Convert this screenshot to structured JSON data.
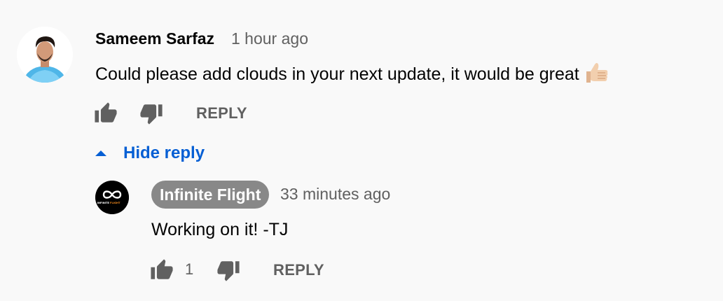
{
  "comment": {
    "author": "Sameem Sarfaz",
    "timestamp": "1 hour ago",
    "text": "Could please add clouds in your next update, it would be great",
    "emoji": "thumbs-up-emoji",
    "avatar": "user-avatar",
    "actions": {
      "like_icon": "thumbs-up-icon",
      "dislike_icon": "thumbs-down-icon",
      "reply_label": "REPLY"
    }
  },
  "replies_toggle": {
    "label": "Hide reply",
    "icon": "caret-up-icon"
  },
  "reply": {
    "author": "Infinite Flight",
    "timestamp": "33 minutes ago",
    "text": "Working on it! -TJ",
    "avatar": "infinite-flight-logo",
    "logo_text_left": "INFINITE",
    "logo_text_right": "FLIGHT",
    "like_count": "1",
    "actions": {
      "like_icon": "thumbs-up-icon",
      "dislike_icon": "thumbs-down-icon",
      "reply_label": "REPLY"
    }
  },
  "colors": {
    "background": "#f9f9f9",
    "link_blue": "#065fd4",
    "secondary_text": "#606060",
    "author_badge": "#888888"
  }
}
